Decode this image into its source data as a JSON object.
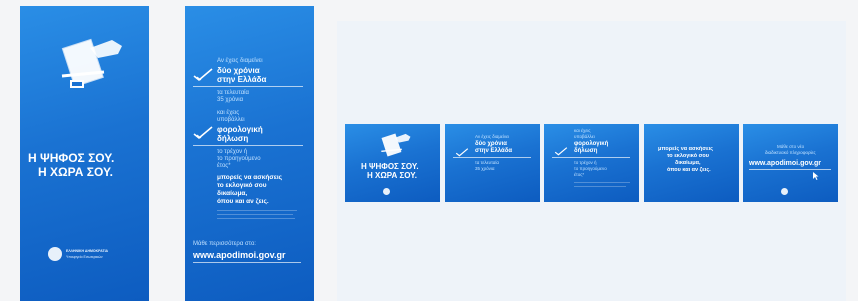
{
  "banner1": {
    "line1": "Η ΨΗΦΟΣ ΣΟΥ.",
    "line2": "Η ΧΩΡΑ ΣΟΥ.",
    "emblem_line1": "ΕΛΛΗΝΙΚΗ ΔΗΜΟΚΡΑΤΙΑ",
    "emblem_line2": "Υπουργείο Εσωτερικών"
  },
  "banner2": {
    "q1": "Αν έχεις διαμείνει",
    "h1": "δύο χρόνια",
    "h2": "στην Ελλάδα",
    "s1": "τα τελευταία",
    "s2": "35 χρόνια",
    "q2a": "και έχεις",
    "q2b": "υποβάλλει",
    "h3": "φορολογική",
    "h4": "δήλωση",
    "s3": "το τρέχον ή",
    "s4": "το προηγούμενο",
    "s5": "έτος*",
    "m1": "μπορείς να ασκήσεις",
    "m2": "το εκλογικό σου",
    "m3": "δικαίωμα,",
    "m4": "όπου και αν ζεις.",
    "cta": "Μάθε περισσότερα στο:",
    "url": "www.apodimoi.gov.gr"
  },
  "slide1": {
    "line1": "Η ΨΗΦΟΣ ΣΟΥ.",
    "line2": "Η ΧΩΡΑ ΣΟΥ."
  },
  "slide2": {
    "q1": "Αν έχεις διαμείνει",
    "h1": "δύο χρόνια",
    "h2": "στην Ελλάδα",
    "s1": "τα τελευταία",
    "s2": "35 χρόνια"
  },
  "slide3": {
    "q1": "και έχεις",
    "q2": "υποβάλλει",
    "h1": "φορολογική",
    "h2": "δήλωση",
    "s1": "το τρέχον ή",
    "s2": "το προηγούμενο",
    "s3": "έτος*"
  },
  "slide4": {
    "m1": "μπορείς να ασκήσεις",
    "m2": "το εκλογικό σου",
    "m3": "δικαίωμα,",
    "m4": "όπου και αν ζεις."
  },
  "slide5": {
    "cta1": "Μάθε στο νέο",
    "cta2": "διαδικτυακό πληροφορίες",
    "url": "www.apodimoi.gov.gr"
  },
  "colors": {
    "brand_blue": "#1a72d2",
    "light_blue": "#bfe0ff",
    "canvas": "#eef3f9",
    "page": "#f4f5f7"
  },
  "icons": [
    "ballot-hand-icon",
    "checkmark-icon",
    "government-seal-icon",
    "cursor-icon"
  ]
}
